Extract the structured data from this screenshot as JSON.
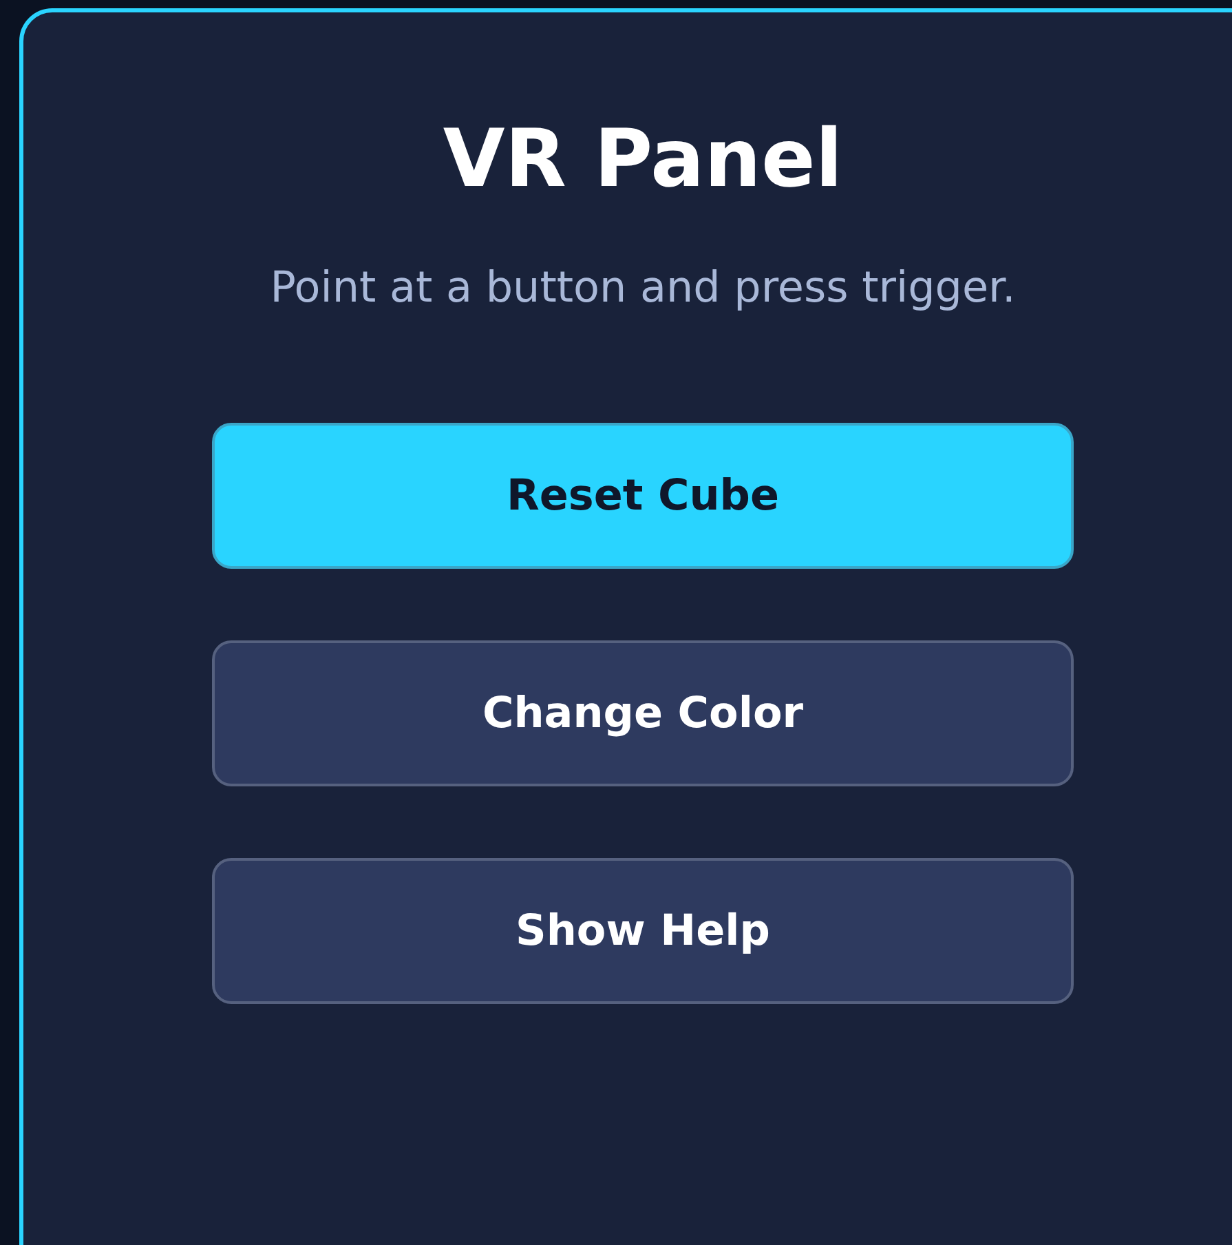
{
  "panel": {
    "title": "VR Panel",
    "subtitle": "Point at a button and press trigger."
  },
  "buttons": [
    {
      "label": "Reset Cube",
      "selected": true
    },
    {
      "label": "Change Color",
      "selected": false
    },
    {
      "label": "Show Help",
      "selected": false
    }
  ]
}
